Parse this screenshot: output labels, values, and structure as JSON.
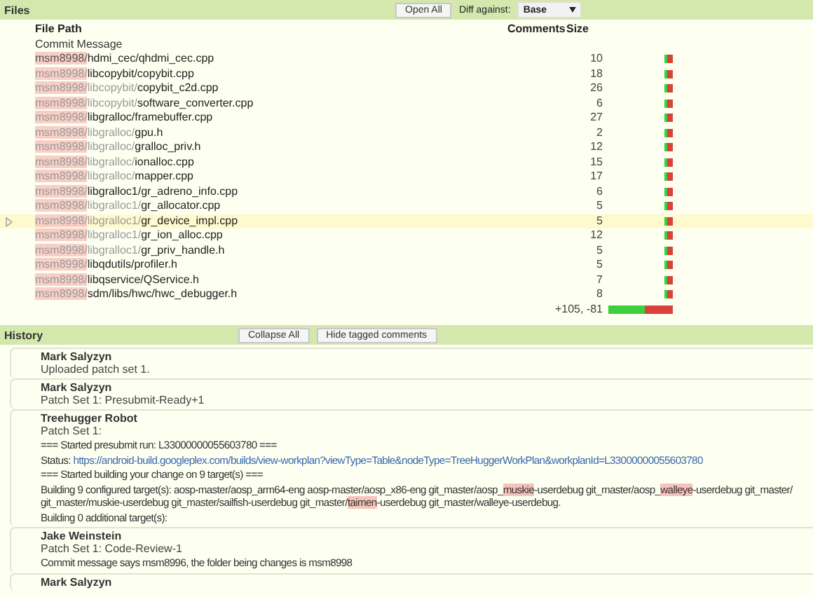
{
  "files_panel": {
    "title": "Files",
    "open_all_button": "Open All",
    "diff_label": "Diff against:",
    "diff_select": "Base",
    "columns": [
      "File Path",
      "Comments",
      "Size"
    ],
    "commit_message": "Commit Message",
    "rows": [
      {
        "selected": false,
        "path": [
          {
            "text": "msm8998/",
            "dim": false
          },
          {
            "text": "hdmi_cec/qhdmi_cec.cpp",
            "dim": false
          }
        ],
        "size": "10"
      },
      {
        "selected": false,
        "path": [
          {
            "text": "msm8998/",
            "dim": true
          },
          {
            "text": "libcopybit/copybit.cpp",
            "dim": false
          }
        ],
        "size": "18"
      },
      {
        "selected": false,
        "path": [
          {
            "text": "msm8998/",
            "dim": true
          },
          {
            "text": "libcopybit/",
            "dim": true
          },
          {
            "text": "copybit_c2d.cpp",
            "dim": false
          }
        ],
        "size": "26"
      },
      {
        "selected": false,
        "path": [
          {
            "text": "msm8998/",
            "dim": true
          },
          {
            "text": "libcopybit/",
            "dim": true
          },
          {
            "text": "software_converter.cpp",
            "dim": false
          }
        ],
        "size": "6"
      },
      {
        "selected": false,
        "path": [
          {
            "text": "msm8998/",
            "dim": true
          },
          {
            "text": "libgralloc/framebuffer.cpp",
            "dim": false
          }
        ],
        "size": "27"
      },
      {
        "selected": false,
        "path": [
          {
            "text": "msm8998/",
            "dim": true
          },
          {
            "text": "libgralloc/",
            "dim": true
          },
          {
            "text": "gpu.h",
            "dim": false
          }
        ],
        "size": "2"
      },
      {
        "selected": false,
        "path": [
          {
            "text": "msm8998/",
            "dim": true
          },
          {
            "text": "libgralloc/",
            "dim": true
          },
          {
            "text": "gralloc_priv.h",
            "dim": false
          }
        ],
        "size": "12"
      },
      {
        "selected": false,
        "path": [
          {
            "text": "msm8998/",
            "dim": true
          },
          {
            "text": "libgralloc/",
            "dim": true
          },
          {
            "text": "ionalloc.cpp",
            "dim": false
          }
        ],
        "size": "15"
      },
      {
        "selected": false,
        "path": [
          {
            "text": "msm8998/",
            "dim": true
          },
          {
            "text": "libgralloc/",
            "dim": true
          },
          {
            "text": "mapper.cpp",
            "dim": false
          }
        ],
        "size": "17"
      },
      {
        "selected": false,
        "path": [
          {
            "text": "msm8998/",
            "dim": true
          },
          {
            "text": "libgralloc1/gr_adreno_info.cpp",
            "dim": false
          }
        ],
        "size": "6"
      },
      {
        "selected": false,
        "path": [
          {
            "text": "msm8998/",
            "dim": true
          },
          {
            "text": "libgralloc1/",
            "dim": true
          },
          {
            "text": "gr_allocator.cpp",
            "dim": false
          }
        ],
        "size": "5"
      },
      {
        "selected": true,
        "path": [
          {
            "text": "msm8998/",
            "dim": true
          },
          {
            "text": "libgralloc1/",
            "dim": true
          },
          {
            "text": "gr_device_impl.cpp",
            "dim": false
          }
        ],
        "size": "5"
      },
      {
        "selected": false,
        "path": [
          {
            "text": "msm8998/",
            "dim": true
          },
          {
            "text": "libgralloc1/",
            "dim": true
          },
          {
            "text": "gr_ion_alloc.cpp",
            "dim": false
          }
        ],
        "size": "12"
      },
      {
        "selected": false,
        "path": [
          {
            "text": "msm8998/",
            "dim": true
          },
          {
            "text": "libgralloc1/",
            "dim": true
          },
          {
            "text": "gr_priv_handle.h",
            "dim": false
          }
        ],
        "size": "5"
      },
      {
        "selected": false,
        "path": [
          {
            "text": "msm8998/",
            "dim": true
          },
          {
            "text": "libqdutils/profiler.h",
            "dim": false
          }
        ],
        "size": "5"
      },
      {
        "selected": false,
        "path": [
          {
            "text": "msm8998/",
            "dim": true
          },
          {
            "text": "libqservice/QService.h",
            "dim": false
          }
        ],
        "size": "7"
      },
      {
        "selected": false,
        "path": [
          {
            "text": "msm8998/",
            "dim": true
          },
          {
            "text": "sdm/libs/hwc/hwc_debugger.h",
            "dim": false
          }
        ],
        "size": "8"
      }
    ],
    "total": {
      "text": "+105, -81",
      "level": 0.56
    }
  },
  "history_panel": {
    "title": "History",
    "collapse_all_button": "Collapse All",
    "hide_tagged_button": "Hide tagged comments",
    "entries": [
      {
        "author": "Mark Salyzyn",
        "summary": "Uploaded patch set 1."
      },
      {
        "author": "Mark Salyzyn",
        "summary": "Patch Set 1: Presubmit-Ready+1"
      },
      {
        "author": "Treehugger Robot",
        "summary": "Patch Set 1:",
        "paragraphs": [
          [
            [
              {
                "kind": "plain",
                "text": "=== Started presubmit run: L33000000055603780 ==="
              }
            ]
          ],
          [
            [
              {
                "kind": "plain",
                "text": "Status: "
              },
              {
                "kind": "link",
                "text": "https://android-build.googleplex.com/builds/view-workplan?viewType=Table&nodeType=TreeHuggerWorkPlan&workplanId=L33000000055603780"
              }
            ]
          ],
          [
            [
              {
                "kind": "plain",
                "text": "=== Started building your change on 9 target(s) ==="
              }
            ]
          ],
          [
            [
              {
                "kind": "plain",
                "text": "Building 9 configured target(s): aosp-master/aosp_arm64-eng aosp-master/aosp_x86-eng git_master/aosp_"
              },
              {
                "kind": "highlight",
                "text": "muskie"
              },
              {
                "kind": "plain",
                "text": "-userdebug git_master/aosp_"
              },
              {
                "kind": "highlight",
                "text": "walleye"
              },
              {
                "kind": "plain",
                "text": "-userdebug git_master/"
              }
            ],
            [
              {
                "kind": "plain",
                "text": "git_master/muskie-userdebug git_master/sailfish-userdebug git_master/"
              },
              {
                "kind": "highlight",
                "text": "taimen"
              },
              {
                "kind": "plain",
                "text": "-userdebug git_master/walleye-userdebug."
              }
            ]
          ],
          [
            [
              {
                "kind": "plain",
                "text": "Building 0 additional target(s):"
              }
            ]
          ]
        ]
      },
      {
        "author": "Jake Weinstein",
        "summary": "Patch Set 1: Code-Review-1",
        "paragraphs": [
          [
            [
              {
                "kind": "plain",
                "text": "Commit message says msm8996, the folder being changes is msm8998"
              }
            ]
          ]
        ]
      },
      {
        "author": "Mark Salyzyn"
      }
    ]
  }
}
